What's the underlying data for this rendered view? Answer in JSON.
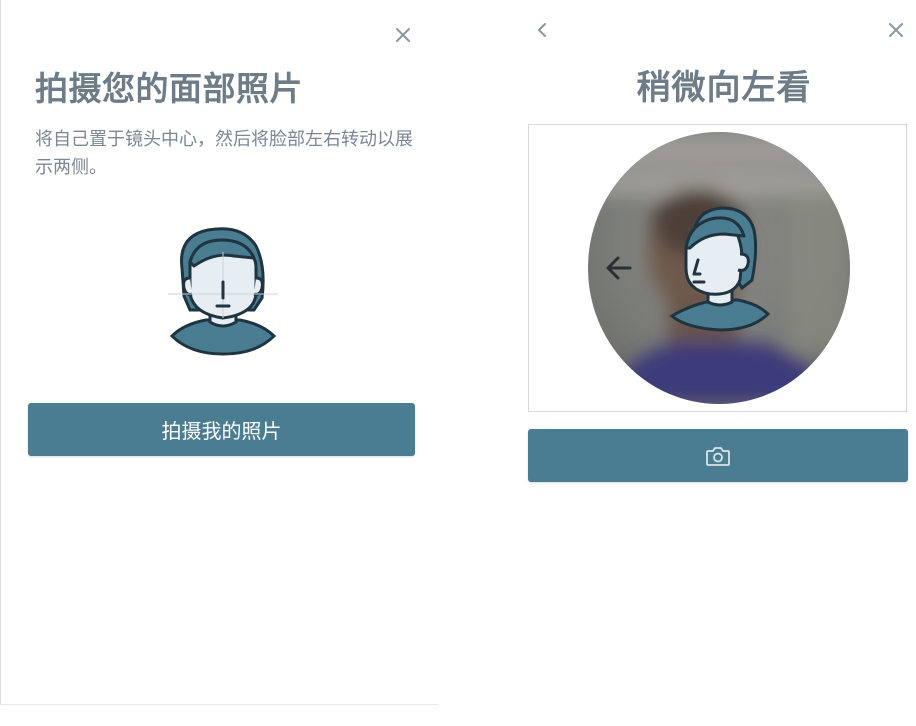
{
  "left": {
    "title": "拍摄您的面部照片",
    "description": "将自己置于镜头中心，然后将脸部左右转动以展示两侧。",
    "button_label": "拍摄我的照片",
    "close_icon": "close-icon"
  },
  "right": {
    "title": "稍微向左看",
    "back_icon": "chevron-left-icon",
    "close_icon": "close-icon",
    "direction_icon": "arrow-left-icon",
    "capture_icon": "camera-icon"
  },
  "colors": {
    "accent": "#4a7d91",
    "heading": "#6e7c88",
    "text": "#7b8794",
    "icon": "#8a96a1"
  }
}
